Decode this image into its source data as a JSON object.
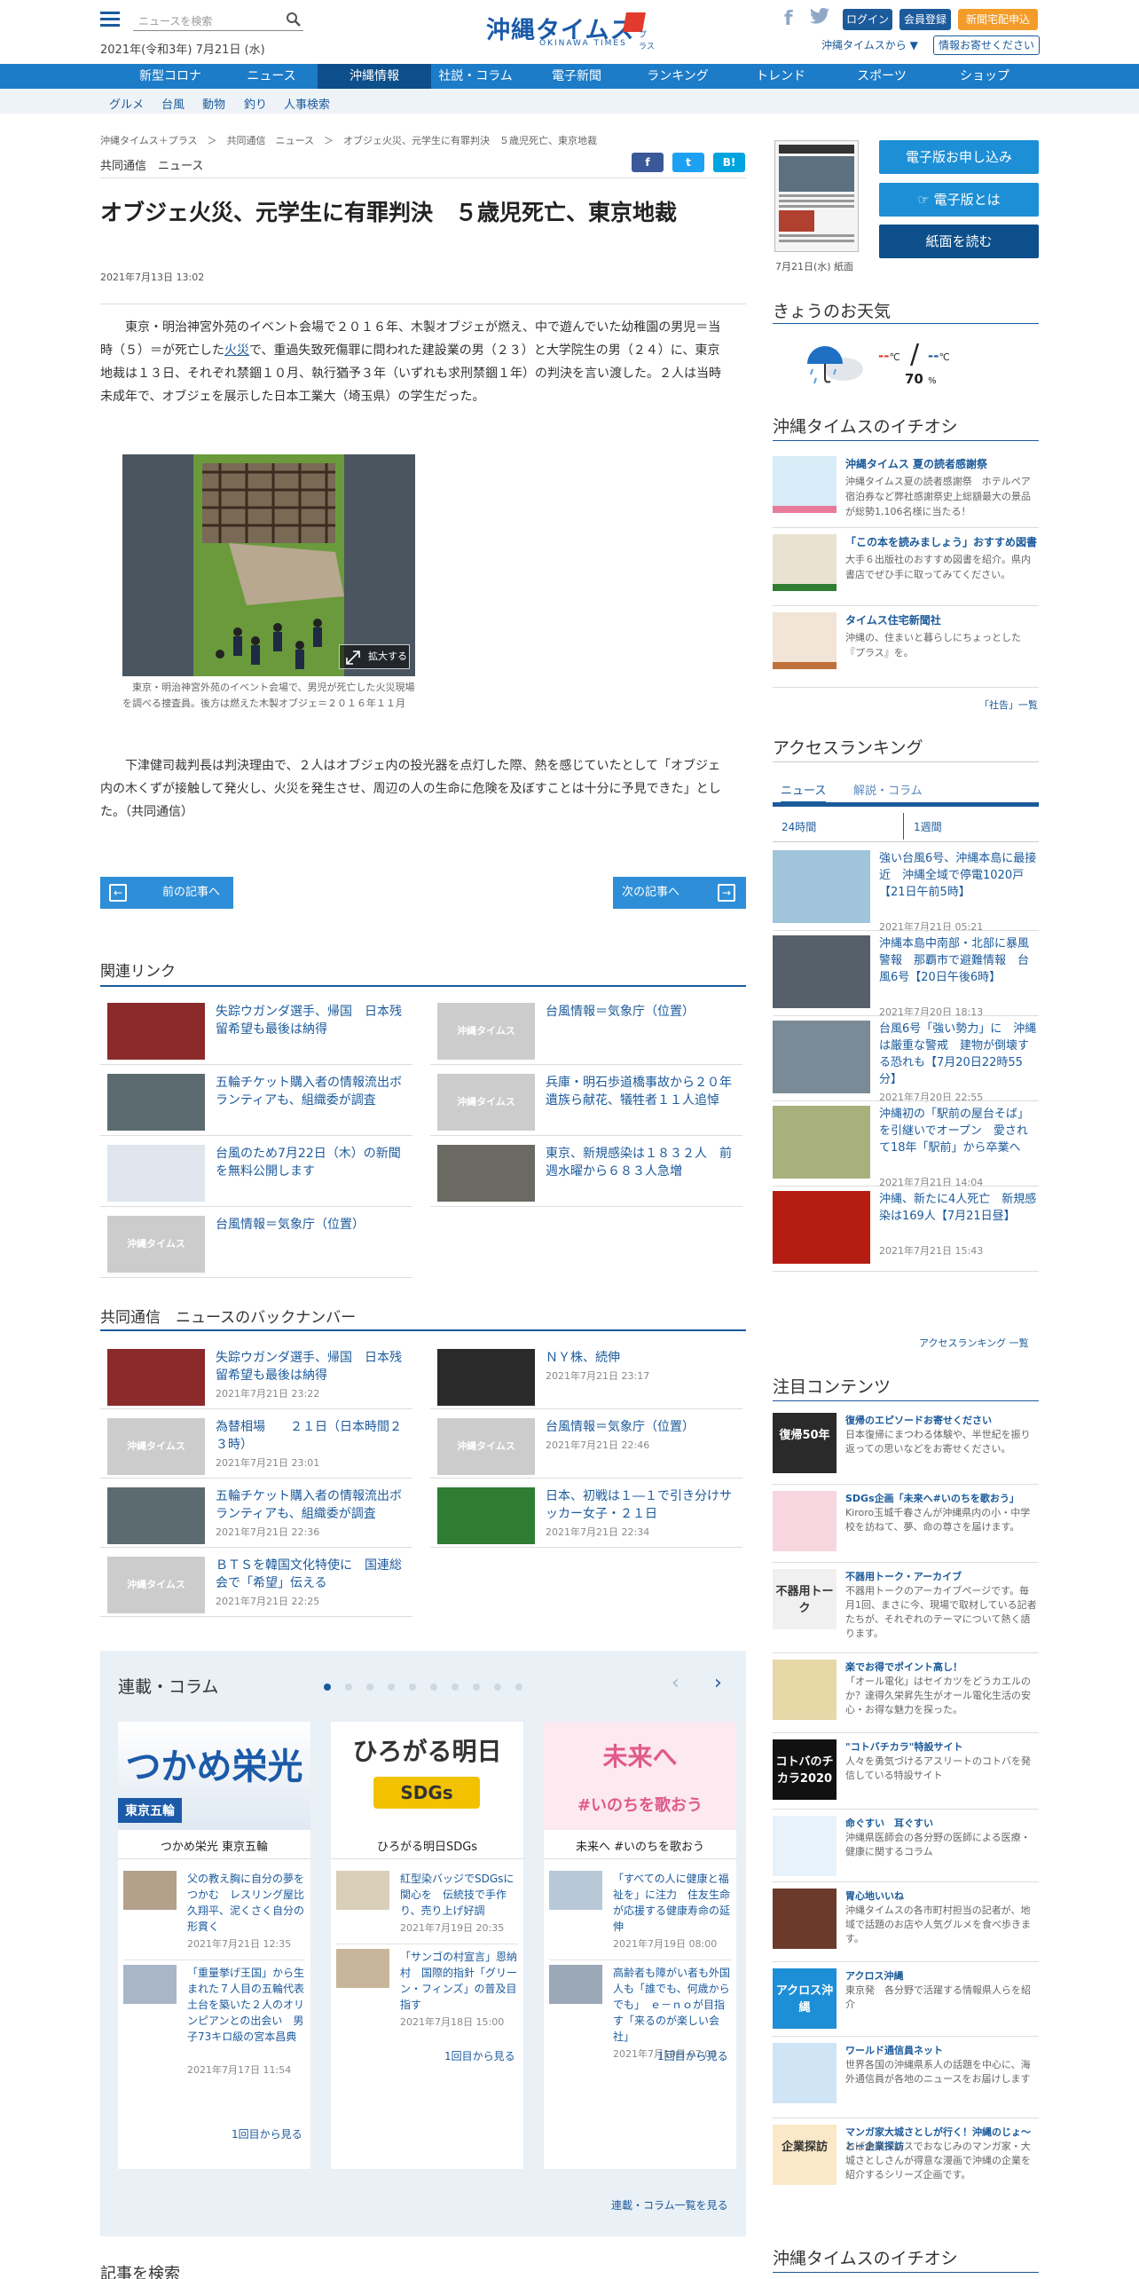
{
  "header": {
    "search_placeholder": "ニュースを検索",
    "date": "2021年(令和3年) 7月21日 (水)",
    "logo_main": "沖縄タイムス",
    "logo_plus": "プラス",
    "logo_sub": "OKINAWA TIMES",
    "login": "ログイン",
    "register": "会員登録",
    "subscribe": "新聞宅配申込",
    "from_okinawa": "沖縄タイムスから",
    "info_request": "情報お寄せください",
    "colors": {
      "primary": "#1d7cc8",
      "dark": "#1b5a9b",
      "accent": "#f39c2a"
    }
  },
  "nav": {
    "items": [
      "新型コロナ",
      "ニュース",
      "沖縄情報",
      "社説・コラム",
      "電子新聞",
      "ランキング",
      "トレンド",
      "スポーツ",
      "ショップ"
    ],
    "active": 2,
    "sub": [
      "グルメ",
      "台風",
      "動物",
      "釣り",
      "人事検索"
    ]
  },
  "article": {
    "breadcrumb": [
      "沖縄タイムス＋プラス",
      "共同通信　ニュース",
      "オブジェ火災、元学生に有罪判決　５歳児死亡、東京地裁"
    ],
    "category": "共同通信　ニュース",
    "share": {
      "fb": "f",
      "tw": "t",
      "hatena": "B!"
    },
    "title": "オブジェ火災、元学生に有罪判決　５歳児死亡、東京地裁",
    "date": "2021年7月13日 13:02",
    "p1a": "東京・明治神宮外苑のイベント会場で２０１６年、木製オブジェが燃え、中で遊んでいた幼稚園の男児＝当時（５）＝が死亡した",
    "p1link": "火災",
    "p1b": "で、重過失致死傷罪に問われた建設業の男（２３）と大学院生の男（２４）に、東京地裁は１３日、それぞれ禁錮１０月、執行猶予３年（いずれも求刑禁錮１年）の判決を言い渡した。２人は当時未成年で、オブジェを展示した日本工業大（埼玉県）の学生だった。",
    "enlarge": "拡大する",
    "caption": "東京・明治神宮外苑のイベント会場で、男児が死亡した火災現場を調べる捜査員。後方は燃えた木製オブジェ＝２０１６年１１月",
    "p2": "下津健司裁判長は判決理由で、２人はオブジェ内の投光器を点灯した際、熱を感じていたとして「オブジェ内の木くずが接触して発火し、火災を発生させ、周辺の人の生命に危険を及ぼすことは十分に予見できた」とした。（共同通信）",
    "prev": "前の記事へ",
    "next": "次の記事へ"
  },
  "related": {
    "title": "関連リンク",
    "placeholder_label": "沖縄タイムス",
    "items": [
      {
        "text": "失踪ウガンダ選手、帰国　日本残留希望も最後は納得"
      },
      {
        "text": "台風情報＝気象庁（位置）"
      },
      {
        "text": "五輪チケット購入者の情報流出ボランティアも、組織委が調査"
      },
      {
        "text": "兵庫・明石歩道橋事故から２０年　遺族ら献花、犠牲者１１人追悼"
      },
      {
        "text": "台風のため7月22日（木）の新聞を無料公開します"
      },
      {
        "text": "東京、新規感染は１８３２人　前週水曜から６８３人急増"
      },
      {
        "text": "台風情報＝気象庁（位置）"
      }
    ]
  },
  "backnumber": {
    "title": "共同通信　ニュースのバックナンバー",
    "items": [
      {
        "text": "失踪ウガンダ選手、帰国　日本残留希望も最後は納得",
        "date": "2021年7月21日 23:22"
      },
      {
        "text": "ＮＹ株、続伸",
        "date": "2021年7月21日 23:17"
      },
      {
        "text": "為替相場　　２１日（日本時間２３時）",
        "date": "2021年7月21日 23:01"
      },
      {
        "text": "台風情報＝気象庁（位置）",
        "date": "2021年7月21日 22:46"
      },
      {
        "text": "五輪チケット購入者の情報流出ボランティアも、組織委が調査",
        "date": "2021年7月21日 22:36"
      },
      {
        "text": "日本、初戦は１―１で引き分けサッカー女子・２１日",
        "date": "2021年7月21日 22:34"
      },
      {
        "text": "ＢＴＳを韓国文化特使に　国連総会で「希望」伝える",
        "date": "2021年7月21日 22:25"
      }
    ]
  },
  "columns": {
    "title": "連載・コラム",
    "dots_total": 10,
    "dots_active": 0,
    "list_all": "連載・コラム一覧を見る",
    "cards": [
      {
        "banner_text": "つかめ栄光",
        "banner_tag": "東京五輪",
        "name": "つかめ栄光 東京五輪",
        "items": [
          {
            "text": "父の教え胸に自分の夢をつかむ　レスリング屋比久翔平、泥くさく自分の形貫く",
            "date": "2021年7月21日 12:35"
          },
          {
            "text": "「重量挙げ王国」から生まれた７人目の五輪代表　土台を築いた２人のオリンピアンとの出会い　男子73キロ級の宮本昌典",
            "date": "2021年7月17日 11:54"
          }
        ],
        "more": "1回目から見る"
      },
      {
        "banner_text": "ひろがる明日",
        "banner_tag": "SDGs",
        "name": "ひろがる明日SDGs",
        "items": [
          {
            "text": "紅型染バッジでSDGsに関心を　伝統技で手作り、売り上げ好調",
            "date": "2021年7月19日 20:35"
          },
          {
            "text": "「サンゴの村宣言」恩納村　国際的指針「グリーン・フィンズ」の普及目指す",
            "date": "2021年7月18日 15:00"
          }
        ],
        "more": "1回目から見る"
      },
      {
        "banner_text": "未来へ",
        "banner_tag": "#いのちを歌おう",
        "name": "未来へ #いのちを歌おう",
        "items": [
          {
            "text": "「すべての人に健康と福祉を」に注力　住友生命が応援する健康寿命の延伸",
            "date": "2021年7月19日 08:00"
          },
          {
            "text": "高齢者も障がい者も外国人も「誰でも、何歳からでも」　ｅ－ｎｏが目指す「来るのが楽しい会社」",
            "date": "2021年7月19日 07:00"
          }
        ],
        "more": "1回目から見る"
      }
    ]
  },
  "search_section": {
    "title": "記事を検索"
  },
  "sidebar": {
    "paper_caption": "7月21日(水) 紙面",
    "btn_apply": "電子版お申し込み",
    "btn_about": "電子版とは",
    "btn_read": "紙面を読む",
    "weather_title": "きょうのお天気",
    "weather_high": "--",
    "weather_low": "--",
    "weather_unit": "℃",
    "weather_rain": "70",
    "weather_rain_unit": "%",
    "picks_title": "沖縄タイムスのイチオシ",
    "picks": [
      {
        "title": "沖縄タイムス 夏の読者感謝祭",
        "desc": "沖縄タイムス夏の読者感謝祭　ホテルペア宿泊券など弊社感謝祭史上総額最大の景品が総勢1,106名様に当たる！"
      },
      {
        "title": "「この本を読みましょう」おすすめ図書",
        "desc": "大手６出版社のおすすめ図書を紹介。県内書店でぜひ手に取ってみてください。"
      },
      {
        "title": "タイムス住宅新聞社",
        "desc": "沖縄の、住まいと暮らしにちょっとした『プラス』を。"
      }
    ],
    "picks_more": "「社告」一覧",
    "ranking_title": "アクセスランキング",
    "ranking_tabs": [
      "ニュース",
      "解説・コラム"
    ],
    "ranking_periods": [
      "24時間",
      "1週間"
    ],
    "ranking": [
      {
        "text": "強い台風6号、沖縄本島に最接近　沖縄全域で停電1020戸【21日午前5時】",
        "date": "2021年7月21日 05:21"
      },
      {
        "text": "沖縄本島中南部・北部に暴風警報　那覇市で避難情報　台風6号【20日午後6時】",
        "date": "2021年7月20日 18:13"
      },
      {
        "text": "台風6号「強い勢力」に　沖縄は厳重な警戒　建物が倒壊する恐れも【7月20日22時55分】",
        "date": "2021年7月20日 22:55"
      },
      {
        "text": "沖縄初の「駅前の屋台そば」を引継いでオープン　愛されて18年「駅前」から卒業へ",
        "date": "2021年7月21日 14:04"
      },
      {
        "text": "沖縄、新たに4人死亡　新規感染は169人【7月21日昼】",
        "date": "2021年7月21日 15:43"
      }
    ],
    "ranking_more": "アクセスランキング 一覧",
    "featured_title": "注目コンテンツ",
    "featured": [
      {
        "title": "復帰のエピソードお寄せください",
        "desc": "日本復帰にまつわる体験や、半世紀を振り返っての思いなどをお寄せください。"
      },
      {
        "title": "SDGs企画「未来へ#いのちを歌おう」",
        "desc": "Kiroro玉城千春さんが沖縄県内の小・中学校を訪ねて、夢、命の尊さを届けます。"
      },
      {
        "title": "不器用トーク・アーカイブ",
        "desc": "不器用トークのアーカイブページです。毎月1回、まさに今、現場で取材している記者たちが、それぞれのテーマについて熱く語ります。"
      },
      {
        "title": "楽でお得でポイント高し！",
        "desc": "「オール電化」はセイカツをどうカエルのか？達得久栄昇先生がオール電化生活の安心・お得な魅力を探った。"
      },
      {
        "title": "\"コトバチカラ\"特設サイト",
        "desc": "人々を勇気づけるアスリートのコトバを発信している特設サイト"
      },
      {
        "title": "命ぐすい　耳ぐすい",
        "desc": "沖縄県医師会の各分野の医師による医療・健康に関するコラム"
      },
      {
        "title": "胃心地いいね",
        "desc": "沖縄タイムスの各市町村担当の記者が、地域で話題のお店や人気グルメを食べ歩きます。"
      },
      {
        "title": "アクロス沖縄",
        "desc": "東京発　各分野で活躍する情報県人らを紹介"
      },
      {
        "title": "ワールド通信員ネット",
        "desc": "世界各国の沖縄県系人の話題を中心に、海外通信員が各地のニュースをお届けします"
      },
      {
        "title": "マンガ家大城さとしが行く！沖縄のじょ～とー企業探訪",
        "desc": "おばあタイムスでおなじみのマンガ家・大城さとしさんが得意な漫画で沖縄の企業を紹介するシリーズ企画です。"
      }
    ],
    "featured_thumb_text": [
      "復帰50年",
      "",
      "不器用トーク",
      "",
      "コトバのチカラ2020",
      "",
      "",
      "アクロス沖縄",
      "",
      "企業探訪"
    ],
    "bottom_title": "沖縄タイムスのイチオシ"
  }
}
